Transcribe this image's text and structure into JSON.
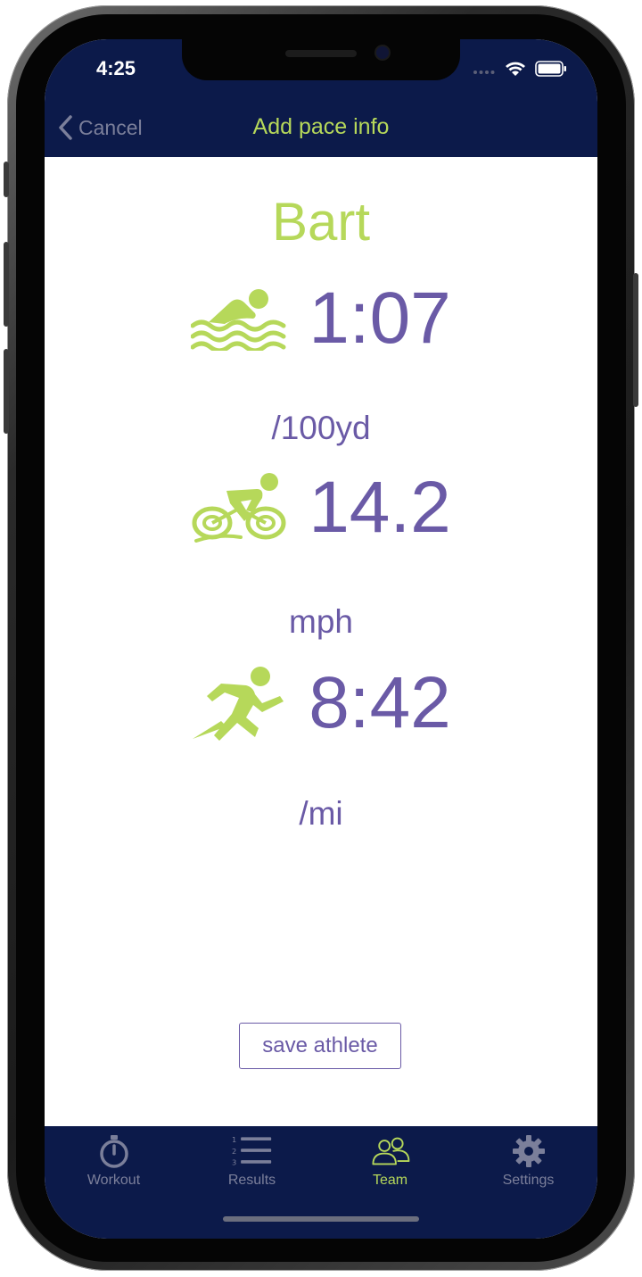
{
  "status_bar": {
    "time": "4:25"
  },
  "nav": {
    "back_label": "Cancel",
    "title": "Add pace info"
  },
  "athlete": {
    "name": "Bart"
  },
  "paces": [
    {
      "sport": "swim",
      "icon": "swimmer-icon",
      "value": "1:07",
      "unit": "/100yd"
    },
    {
      "sport": "bike",
      "icon": "cyclist-icon",
      "value": "14.2",
      "unit": "mph"
    },
    {
      "sport": "run",
      "icon": "runner-icon",
      "value": "8:42",
      "unit": "/mi"
    }
  ],
  "actions": {
    "save_label": "save athlete"
  },
  "tabs": [
    {
      "label": "Workout",
      "icon": "stopwatch-icon",
      "active": false
    },
    {
      "label": "Results",
      "icon": "list-icon",
      "active": false
    },
    {
      "label": "Team",
      "icon": "team-icon",
      "active": true
    },
    {
      "label": "Settings",
      "icon": "gear-icon",
      "active": false
    }
  ],
  "colors": {
    "nav_background": "#0c1a4a",
    "accent_green": "#b6d85a",
    "accent_purple": "#6a5aa6",
    "inactive_gray": "#7b7f9a"
  }
}
